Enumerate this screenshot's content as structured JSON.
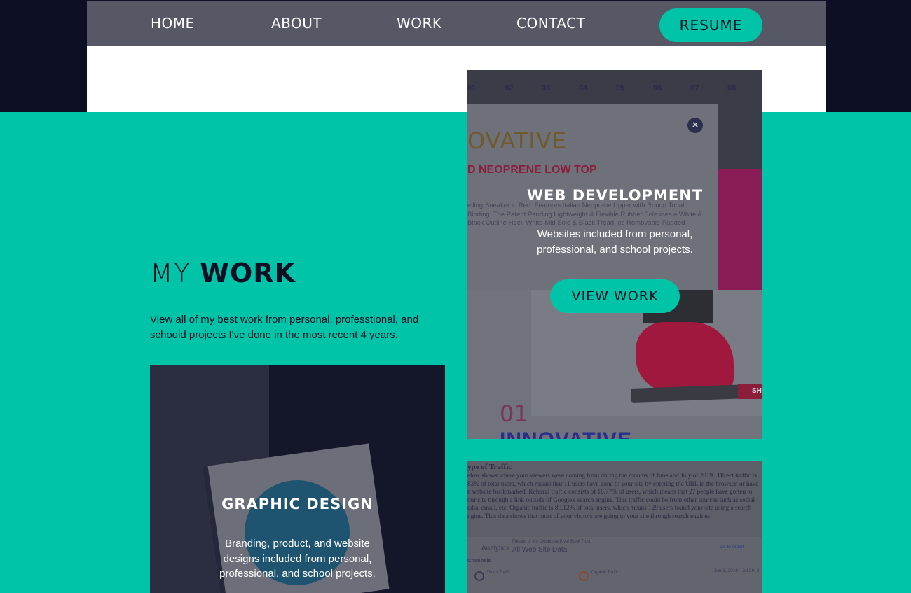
{
  "nav": {
    "items": [
      "HOME",
      "ABOUT",
      "WORK",
      "CONTACT"
    ],
    "resume_label": "RESUME"
  },
  "section": {
    "heading_light": "MY ",
    "heading_bold": "WORK",
    "intro": "View all of my best work from personal, professtional, and schoold projects I've done in the most recent 4 years."
  },
  "cards": {
    "web": {
      "title": "WEB DEVELOPMENT",
      "text": "Websites included from personal, professional, and school projects.",
      "button": "VIEW WORK",
      "close_glyph": "×",
      "bg": {
        "numbers": [
          "01",
          "02",
          "03",
          "04",
          "05",
          "06",
          "07",
          "08"
        ],
        "ovative": "OVATIVE",
        "product": "D NEOPRENE LOW TOP",
        "desc": "elling Sneaker in Red. Features Italian Neoprene Upper with Round Tonal Binding. The Patent Pending Lightweight & Flexible Rubber Sole ines a White & Black Outline Heel, White Mid Sole & Black Tread. es Removable Padded",
        "sh": "SH",
        "big_num": "01",
        "innovative": "INNOVATIVE"
      }
    },
    "graphic": {
      "title": "GRAPHIC DESIGN",
      "text": "Branding, product, and website designs included from personal, professional, and school projects."
    },
    "analytics": {
      "heading": "ype of Traffic",
      "para": "elow shows where your viewers were coming from during the months of June and July of 2019 . Direct traffic is 83% of total users, which means that 11 users have gone to your site by entering the URL in the browser, or have e website bookmarked. Referral traffic consists of 16.77% of users, which means that 27 people have gotten to our site through a link outside of Google's search engine. This traffic could be from other sources such as social edia, email, etc. Organic traffic is 80.12% of total users, which means 129 users found your site using a search ngine. This data shows that most of your visitors are going to your site through search engines.",
      "logo": "Analytics",
      "subtitle": "Friends of the Oklahoma River Bank Trust",
      "site": "All Web Site Data",
      "report": "Go to report",
      "channels": "Channels",
      "direct": "Direct Traffic",
      "organic": "Organic Traffic",
      "date_range": "Jun 1, 2019 - Jul 29, 2"
    }
  },
  "colors": {
    "accent": "#00c4a7",
    "dark": "#0d1024",
    "nav_bg": "#565865"
  }
}
